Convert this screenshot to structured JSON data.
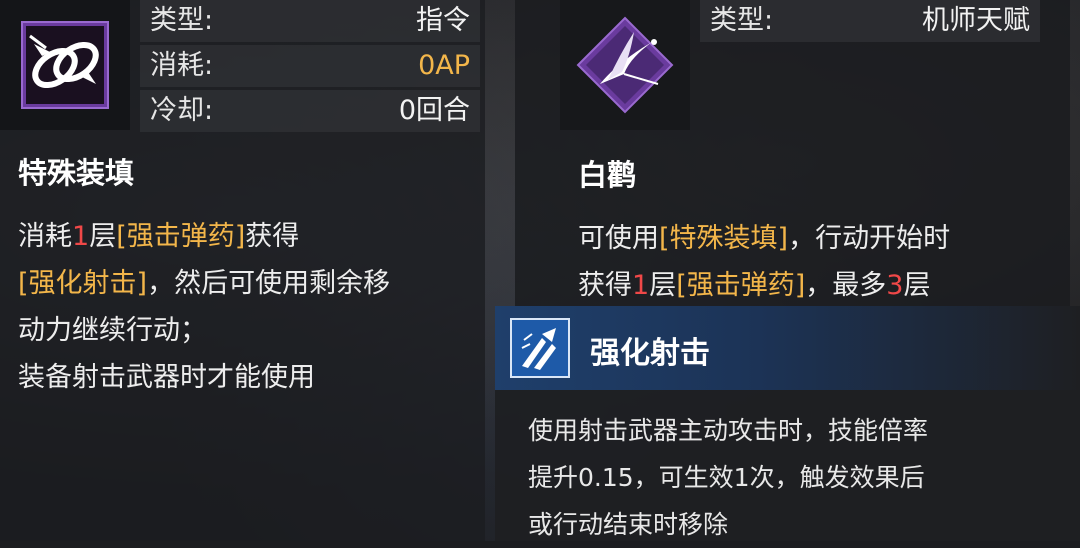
{
  "left_card": {
    "icon": "linked-rings-strike-icon",
    "stats": [
      {
        "key": "类型:",
        "value": "指令"
      },
      {
        "key": "消耗:",
        "value": "0AP"
      },
      {
        "key": "冷却:",
        "value": "0回合"
      }
    ],
    "skill_name": "特殊装填",
    "desc": {
      "l1a": "消耗",
      "l1b": "1",
      "l1c": "层",
      "l1d": "[强击弹药]",
      "l1e": "获得",
      "l2a": "[强化射击]",
      "l2b": "，然后可使用剩余移",
      "l3": "动力继续行动；",
      "l4": "装备射击武器时才能使用"
    }
  },
  "right_card": {
    "icon": "white-crane-icon",
    "stats": [
      {
        "key": "类型:",
        "value": "机师天赋"
      }
    ],
    "skill_name": "白鹳",
    "desc": {
      "l1a": "可使用",
      "l1b": "[特殊装填]",
      "l1c": "，行动开始时",
      "l2a": "获得",
      "l2b": "1",
      "l2c": "层",
      "l2d": "[强击弹药]",
      "l2e": "，最多",
      "l2f": "3",
      "l2g": "层"
    }
  },
  "popup": {
    "icon": "shooting-boost-icon",
    "title": "强化射击",
    "desc": {
      "l1": "使用射击武器主动攻击时，技能倍率",
      "l2": "提升0.15，可生效1次，触发效果后",
      "l3": "或行动结束时移除"
    }
  },
  "colors": {
    "highlight": "#f3b64a",
    "count": "#f04848",
    "icon_purple": "#6a3b9e",
    "popup_header_blue": "#1f3f6b"
  }
}
